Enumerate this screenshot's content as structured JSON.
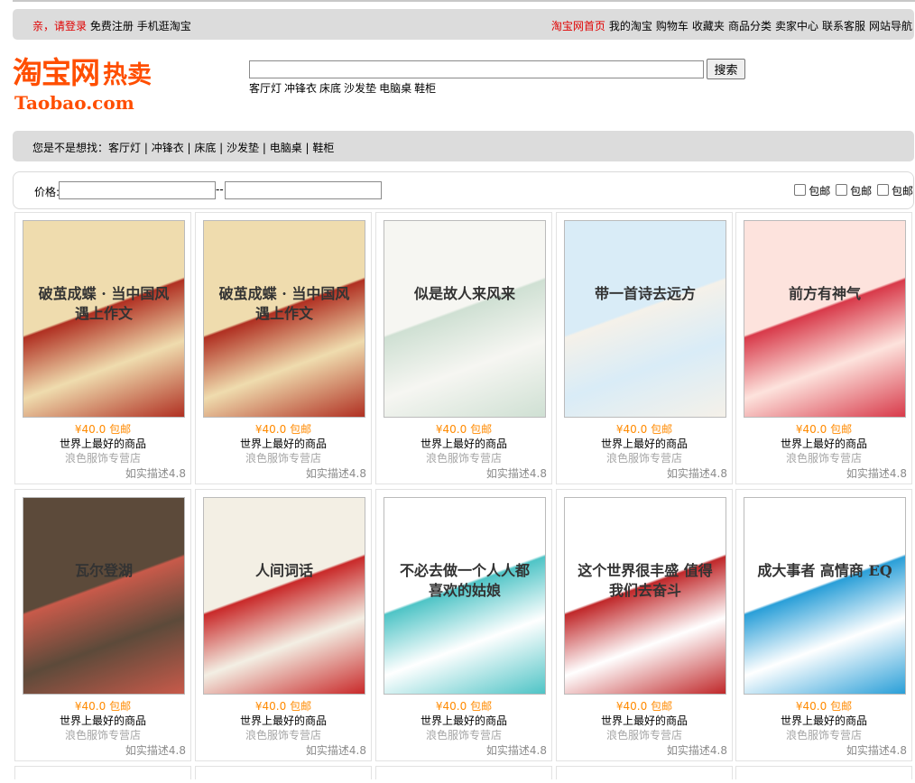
{
  "topbar": {
    "greeting": "亲，请登录",
    "register": "免费注册",
    "mobile": "手机逛淘宝",
    "links": [
      "淘宝网首页",
      "我的淘宝",
      "购物车",
      "收藏夹",
      "商品分类",
      "卖家中心",
      "联系客服",
      "网站导航"
    ]
  },
  "logo": {
    "cn_main": "淘宝网",
    "cn_hot": "热卖",
    "en": "Taobao.com"
  },
  "search": {
    "value": "",
    "button": "搜索",
    "hot_words": [
      "客厅灯",
      "冲锋衣",
      "床底",
      "沙发垫",
      "电脑桌",
      "鞋柜"
    ]
  },
  "suggest": {
    "label": "您是不是想找：",
    "text": "客厅灯 | 冲锋衣 | 床底 | 沙发垫 | 电脑桌 | 鞋柜"
  },
  "filter": {
    "price_label": "价格:",
    "separator": "--",
    "checks": [
      "包邮",
      "包邮",
      "包邮"
    ]
  },
  "products": [
    {
      "price": "¥40.0 包邮",
      "name": "世界上最好的商品",
      "shop": "浪色服饰专营店",
      "rating": "如实描述4.8",
      "cover": "破茧成蝶 · 当中国风遇上作文",
      "colors": [
        "#efdcae",
        "#b03022"
      ]
    },
    {
      "price": "¥40.0 包邮",
      "name": "世界上最好的商品",
      "shop": "浪色服饰专营店",
      "rating": "如实描述4.8",
      "cover": "破茧成蝶 · 当中国风遇上作文",
      "colors": [
        "#efdcae",
        "#b03022"
      ]
    },
    {
      "price": "¥40.0 包邮",
      "name": "世界上最好的商品",
      "shop": "浪色服饰专营店",
      "rating": "如实描述4.8",
      "cover": "似是故人来风来",
      "colors": [
        "#f6f6f2",
        "#cfe0d3"
      ]
    },
    {
      "price": "¥40.0 包邮",
      "name": "世界上最好的商品",
      "shop": "浪色服饰专营店",
      "rating": "如实描述4.8",
      "cover": "带一首诗去远方",
      "colors": [
        "#d9ecf7",
        "#f5f1e9"
      ]
    },
    {
      "price": "¥40.0 包邮",
      "name": "世界上最好的商品",
      "shop": "浪色服饰专营店",
      "rating": "如实描述4.8",
      "cover": "前方有神气",
      "colors": [
        "#fde3dd",
        "#d83a4a"
      ]
    },
    {
      "price": "¥40.0 包邮",
      "name": "世界上最好的商品",
      "shop": "浪色服饰专营店",
      "rating": "如实描述4.8",
      "cover": "瓦尔登湖",
      "colors": [
        "#5c4a3a",
        "#c85a4a"
      ]
    },
    {
      "price": "¥40.0 包邮",
      "name": "世界上最好的商品",
      "shop": "浪色服饰专营店",
      "rating": "如实描述4.8",
      "cover": "人间词话",
      "colors": [
        "#f3efe4",
        "#c92a2a"
      ]
    },
    {
      "price": "¥40.0 包邮",
      "name": "世界上最好的商品",
      "shop": "浪色服饰专营店",
      "rating": "如实描述4.8",
      "cover": "不必去做一个人人都喜欢的姑娘",
      "colors": [
        "#ffffff",
        "#4fc4c6"
      ]
    },
    {
      "price": "¥40.0 包邮",
      "name": "世界上最好的商品",
      "shop": "浪色服饰专营店",
      "rating": "如实描述4.8",
      "cover": "这个世界很丰盛 值得我们去奋斗",
      "colors": [
        "#ffffff",
        "#c0282a"
      ]
    },
    {
      "price": "¥40.0 包邮",
      "name": "世界上最好的商品",
      "shop": "浪色服饰专营店",
      "rating": "如实描述4.8",
      "cover": "成大事者 高情商 EQ",
      "colors": [
        "#ffffff",
        "#2a9fd8"
      ]
    }
  ]
}
